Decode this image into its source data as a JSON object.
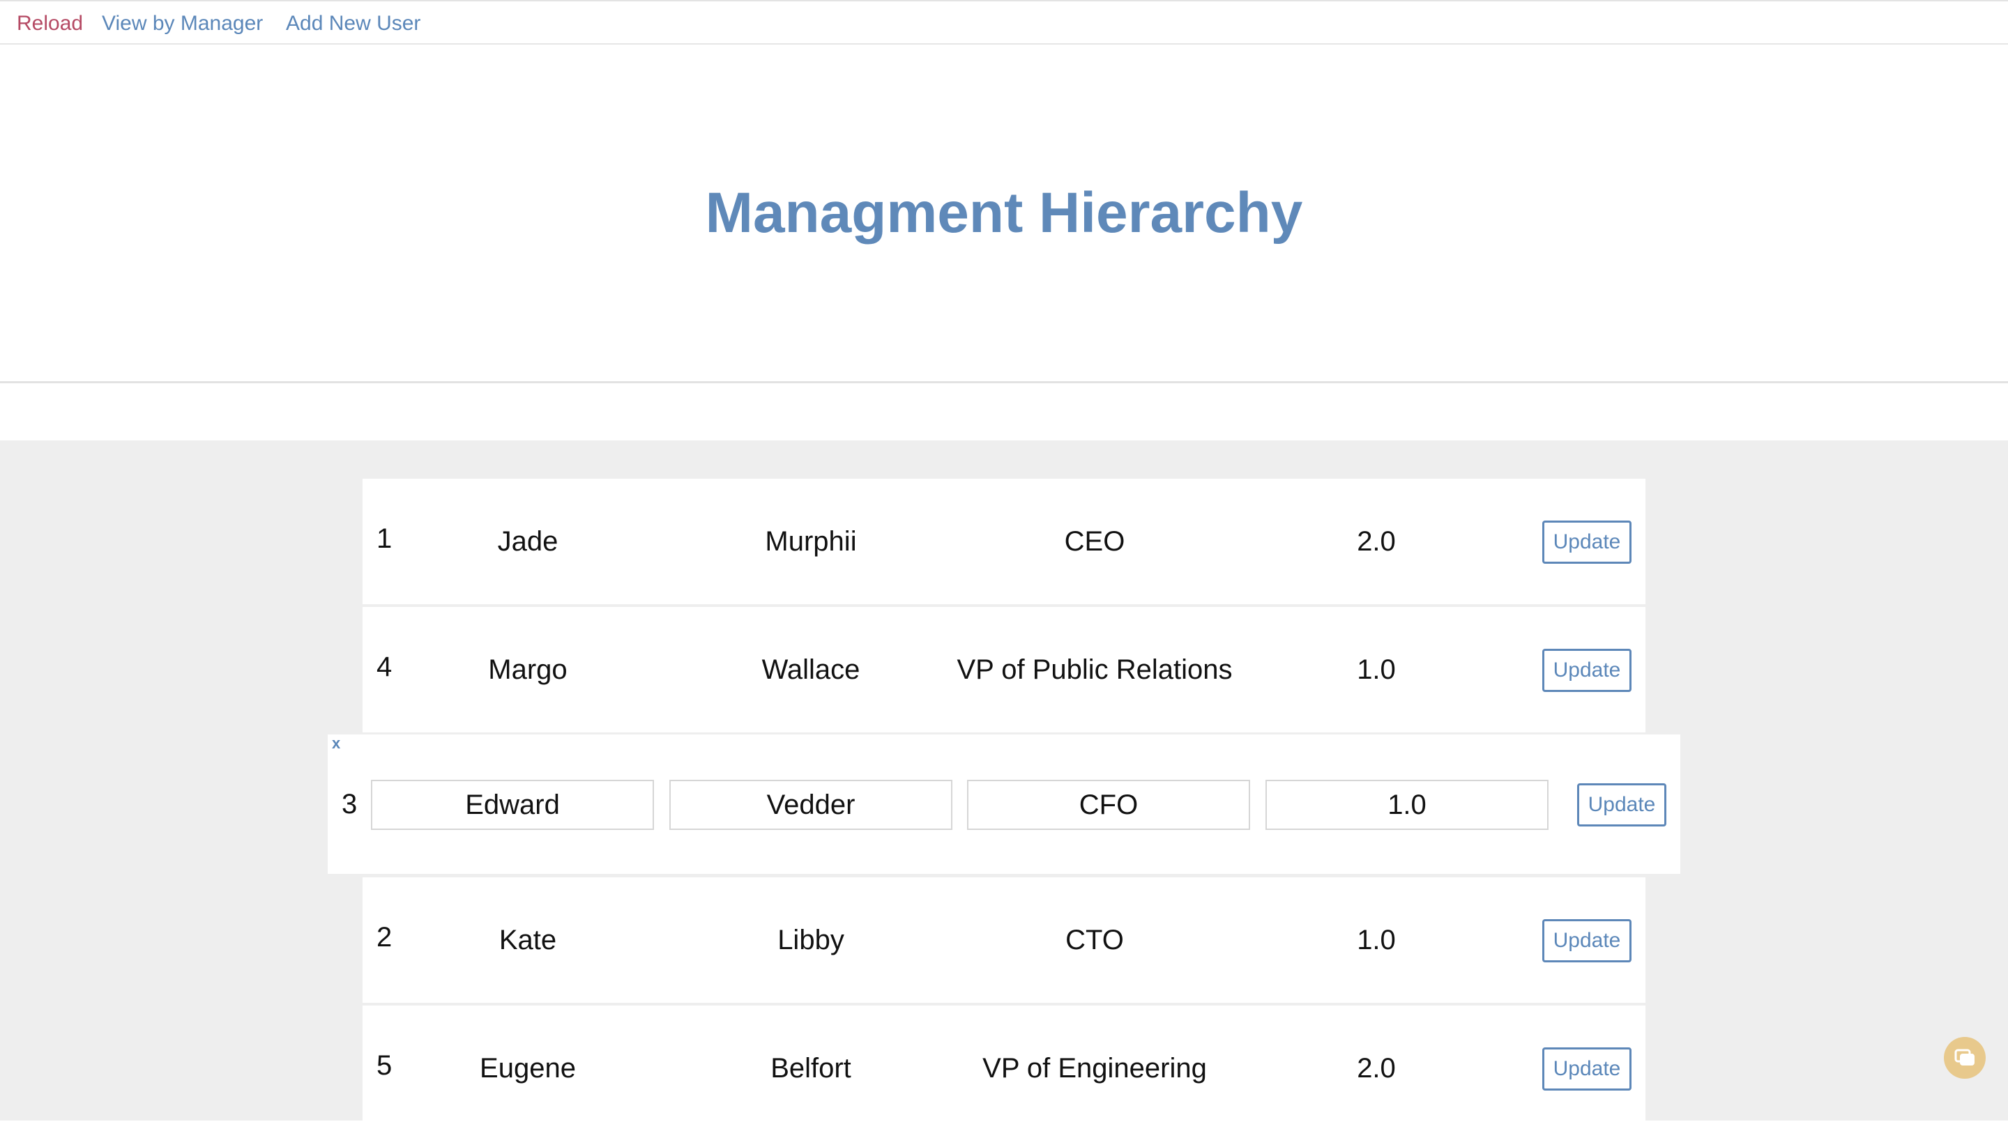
{
  "nav": {
    "reload": "Reload",
    "view_by_manager": "View by Manager",
    "add_new_user": "Add New User"
  },
  "header": {
    "title": "Managment Hierarchy"
  },
  "buttons": {
    "update": "Update",
    "close": "x"
  },
  "rows": [
    {
      "id": "1",
      "first": "Jade",
      "last": "Murphii",
      "title": "CEO",
      "rank": "2.0"
    },
    {
      "id": "4",
      "first": "Margo",
      "last": "Wallace",
      "title": "VP of Public Relations",
      "rank": "1.0"
    },
    {
      "id": "3",
      "first": "Edward",
      "last": "Vedder",
      "title": "CFO",
      "rank": "1.0",
      "editing": true
    },
    {
      "id": "2",
      "first": "Kate",
      "last": "Libby",
      "title": "CTO",
      "rank": "1.0"
    },
    {
      "id": "5",
      "first": "Eugene",
      "last": "Belfort",
      "title": "VP of Engineering",
      "rank": "2.0"
    }
  ],
  "colors": {
    "link": "#5b87b9",
    "active_link": "#b54a64",
    "title": "#5f89b9",
    "content_bg": "#eeeeee"
  },
  "icons": {
    "chat": "chat-bubble-icon"
  }
}
